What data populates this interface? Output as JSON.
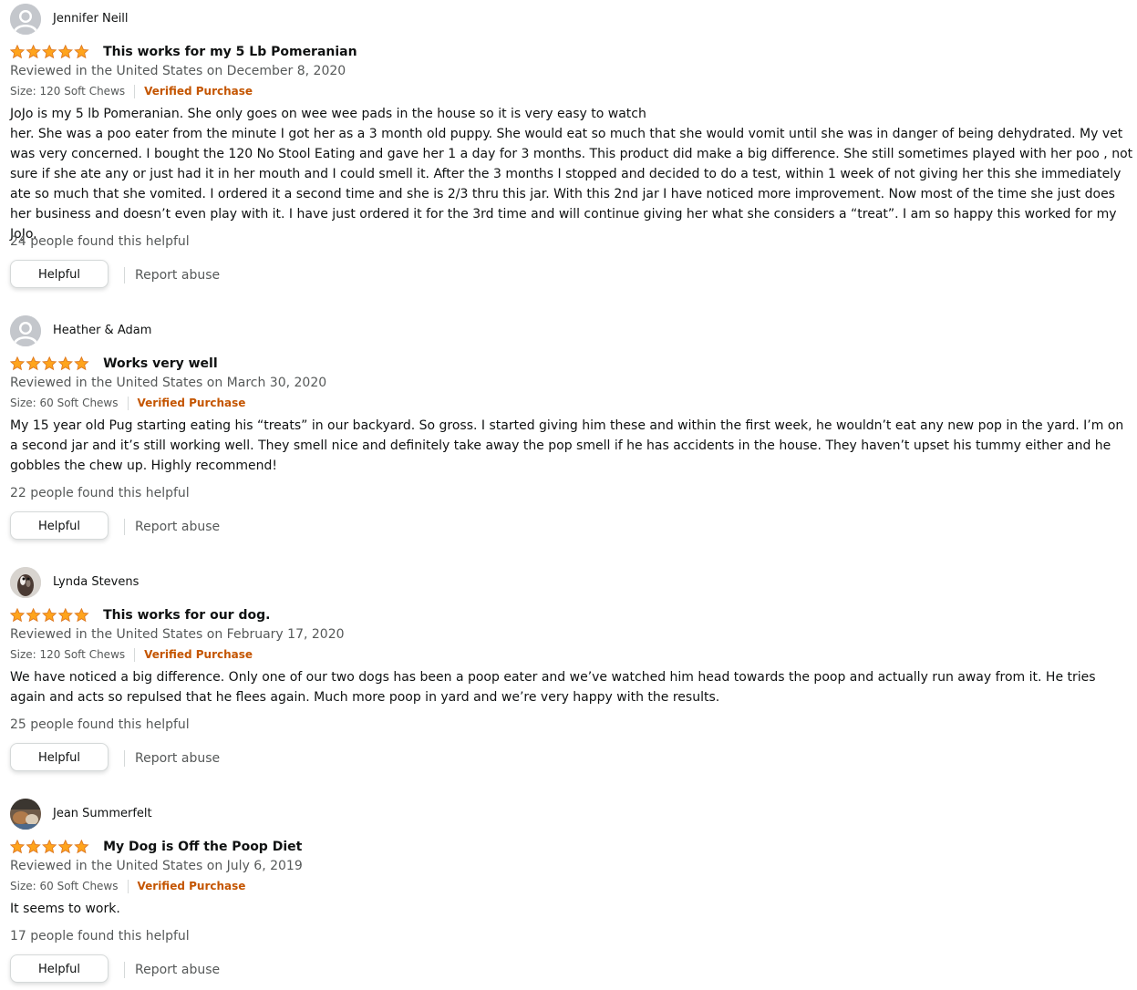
{
  "colors": {
    "star": "#ffa41c",
    "star_outline": "#de7921",
    "verified": "#c45500",
    "muted_text": "#565959"
  },
  "reviews": [
    {
      "avatar": "default-avatar-icon",
      "author": "Jennifer Neill",
      "rating": 5,
      "title": "This works for my 5 Lb Pomeranian",
      "date": "Reviewed in the United States on December 8, 2020",
      "variant": "Size: 120 Soft Chews",
      "verified": "Verified Purchase",
      "body": "JoJo is my 5 lb Pomeranian. She only goes on wee wee pads in the house so it is very easy to watch\nher. She was a poo eater from the minute I got her as a 3 month old puppy. She would eat so much that she would vomit until she was in danger of being dehydrated. My vet was very concerned. I bought the 120 No Stool Eating and gave her 1 a day for 3 months. This product did make a big difference. She still sometimes played with her poo , not sure if she ate any or just had it in her mouth and I could smell it. After the 3 months I stopped and decided to do a test, within 1 week of not giving her this she immediately ate so much that she vomited. I ordered it a second time and she is 2/3 thru this jar. With this 2nd jar I have noticed more improvement. Now most of the time she just does her business and doesn’t even play with it. I have just ordered it for the 3rd time and will continue giving her what she considers a “treat”. I am so happy this worked for my JoJo.",
      "helpful_count": "24 people found this helpful",
      "helpful_button": "Helpful",
      "report": "Report abuse"
    },
    {
      "avatar": "default-avatar-icon",
      "author": "Heather & Adam",
      "rating": 5,
      "title": "Works very well",
      "date": "Reviewed in the United States on March 30, 2020",
      "variant": "Size: 60 Soft Chews",
      "verified": "Verified Purchase",
      "body": "My 15 year old Pug starting eating his “treats” in our backyard. So gross. I started giving him these and within the first week, he wouldn’t eat any new pop in the yard. I’m on a second jar and it’s still working well. They smell nice and definitely take away the pop smell if he has accidents in the house. They haven’t upset his tummy either and he gobbles the chew up. Highly recommend!",
      "helpful_count": "22 people found this helpful",
      "helpful_button": "Helpful",
      "report": "Report abuse"
    },
    {
      "avatar": "dog-photo-avatar",
      "author": "Lynda Stevens",
      "rating": 5,
      "title": "This works for our dog.",
      "date": "Reviewed in the United States on February 17, 2020",
      "variant": "Size: 120 Soft Chews",
      "verified": "Verified Purchase",
      "body": "We have noticed a big difference. Only one of our two dogs has been a poop eater and we’ve watched him head towards the poop and actually run away from it. He tries again and acts so repulsed that he flees again. Much more poop in yard and we’re very happy with the results.",
      "helpful_count": "25 people found this helpful",
      "helpful_button": "Helpful",
      "report": "Report abuse"
    },
    {
      "avatar": "photo-avatar",
      "author": "Jean Summerfelt",
      "rating": 5,
      "title": "My Dog is Off the Poop Diet",
      "date": "Reviewed in the United States on July 6, 2019",
      "variant": "Size: 60 Soft Chews",
      "verified": "Verified Purchase",
      "body": "It seems to work.",
      "helpful_count": "17 people found this helpful",
      "helpful_button": "Helpful",
      "report": "Report abuse"
    }
  ]
}
